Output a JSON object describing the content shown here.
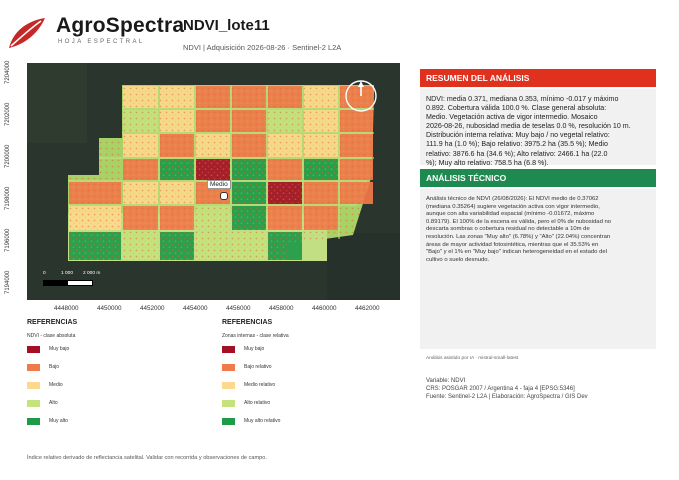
{
  "brand": {
    "name": "AgroSpectra",
    "tagline": "HOJA ESPECTRAL"
  },
  "header": {
    "title": "NDVI_lote11",
    "subtitle": "NDVI | Adquisición 2026-08-26 · Sentinel-2 L2A"
  },
  "map": {
    "y_ticks": [
      "7204000",
      "7202000",
      "7200000",
      "7198000",
      "7196000",
      "7194000"
    ],
    "x_ticks": [
      "4448000",
      "4450000",
      "4452000",
      "4454000",
      "4456000",
      "4458000",
      "4460000",
      "4462000"
    ],
    "place_label": "Medio",
    "scale_labels": [
      "0",
      "1 000",
      "2 000 m"
    ]
  },
  "summary": {
    "heading": "RESUMEN DEL ANÁLISIS",
    "heading_color": "#e0301e",
    "lines": [
      "NDVI: media 0.371, mediana 0.353, mínimo -0.017 y máximo",
      "0.892. Cobertura válida 100.0 %. Clase general absoluta:",
      "Medio. Vegetación activa de vigor intermedio. Mosaico",
      "2026-08-26, nubosidad media de teselas 0.0 %, resolución 10 m.",
      "Distribución interna relativa: Muy bajo / no vegetal relativo:",
      "111.9 ha (1.0 %); Bajo relativo: 3975.2 ha (35.5 %); Medio",
      "relativo: 3876.6 ha (34.6 %); Alto relativo: 2466.1 ha (22.0",
      "%); Muy alto relativo: 758.5 ha (6.8 %)."
    ]
  },
  "technical": {
    "heading": "ANÁLISIS TÉCNICO",
    "heading_color": "#1e8a50",
    "lines": [
      "Análisis técnico de NDVI (26/08/2026): El NDVI medio de 0.37062",
      "(mediana 0.35264) sugiere vegetación activa con vigor intermedio,",
      "aunque con alta variabilidad espacial (mínimo -0.01672, máximo",
      "0.89179). El 100% de la escena es válida, pero el 0% de nubosidad no",
      "descarta sombras o cobertura residual no detectable a 10m de",
      "resolución. Las zonas \"Muy alto\" (6.78%) y \"Alto\" (22.04%) concentran",
      "áreas de mayor actividad fotosintética, mientras que el 35.53% en",
      "\"Bajo\" y el 1% en \"Muy bajo\" indican heterogeneidad en el estado del",
      "cultivo o suelo desnudo."
    ]
  },
  "ai_note": "Análisis asistido por IA · mistral-small-latest",
  "metadata": {
    "variable": "Variable: NDVI",
    "crs": "CRS: POSGAR 2007 / Argentina 4 - faja 4 [EPSG:5346]",
    "source": "Fuente: Sentinel-2 L2A | Elaboración: AgroSpectra / GIS Dev"
  },
  "legend_absolute": {
    "title": "REFERENCIAS",
    "subtitle": "NDVI - clase absoluta",
    "items": [
      {
        "label": "Muy bajo",
        "color": "#a50f26"
      },
      {
        "label": "Bajo",
        "color": "#f07a4a"
      },
      {
        "label": "Medio",
        "color": "#fcd98c"
      },
      {
        "label": "Alto",
        "color": "#c5e27c"
      },
      {
        "label": "Muy alto",
        "color": "#1f9a48"
      }
    ]
  },
  "legend_relative": {
    "title": "REFERENCIAS",
    "subtitle": "Zonas internas - clase relativa",
    "items": [
      {
        "label": "Muy bajo",
        "color": "#a50f26"
      },
      {
        "label": "Bajo relativo",
        "color": "#f07a4a"
      },
      {
        "label": "Medio relativo",
        "color": "#fcd98c"
      },
      {
        "label": "Alto relativo",
        "color": "#c5e27c"
      },
      {
        "label": "Muy alto relativo",
        "color": "#1f9a48"
      }
    ]
  },
  "footer": "Índice relativo derivado de reflectancia satelital. Validar con recorrida y observaciones de campo."
}
